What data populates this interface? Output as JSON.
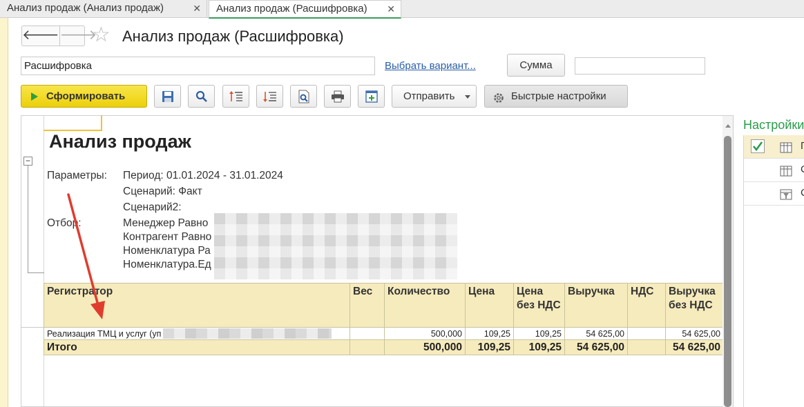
{
  "tabs": [
    {
      "label": "Анализ продаж (Анализ продаж)"
    },
    {
      "label": "Анализ продаж (Расшифровка)"
    }
  ],
  "header": {
    "title": "Анализ продаж (Расшифровка)",
    "back_icon": "arrow-left-icon",
    "forward_icon": "arrow-right-icon",
    "favorite_icon": "star-icon"
  },
  "variant": {
    "value": "Расшифровка",
    "choose_link": "Выбрать вариант...",
    "sum_button": "Сумма",
    "sum_value": ""
  },
  "toolbar": {
    "generate": "Сформировать",
    "send": "Отправить",
    "quick_settings": "Быстрые настройки",
    "icons": [
      "save-icon",
      "search-icon",
      "expand-groups-icon",
      "collapse-groups-icon",
      "print-preview-icon",
      "print-icon",
      "new-window-icon"
    ]
  },
  "report": {
    "title": "Анализ продаж",
    "params_label": "Параметры:",
    "params": [
      "Период: 01.01.2024 - 31.01.2024",
      "Сценарий: Факт",
      "Сценарий2:"
    ],
    "filter_label": "Отбор:",
    "filters": [
      "Менеджер Равно",
      "Контрагент Равно",
      "Номенклатура Ра",
      "Номенклатура.Ед"
    ],
    "columns": [
      "Регистратор",
      "Вес",
      "Количество",
      "Цена",
      "Цена без НДС",
      "Выручка",
      "НДС",
      "Выручка без НДС"
    ],
    "rows": [
      [
        "Реализация ТМЦ и услуг (уп",
        "",
        "500,000",
        "109,25",
        "109,25",
        "54 625,00",
        "",
        "54 625,00"
      ]
    ],
    "total": [
      "Итого",
      "",
      "500,000",
      "109,25",
      "109,25",
      "54 625,00",
      "",
      "54 625,00"
    ]
  },
  "settings_panel": {
    "title": "Настройки",
    "items": [
      {
        "label": "П",
        "checked": true
      },
      {
        "label": "С",
        "checked": false
      },
      {
        "label": "С",
        "checked": false
      }
    ]
  },
  "colors": {
    "accent_green": "#2a9c4b",
    "generate_button": "#ecd00a",
    "table_header": "#f6ebbd",
    "annotation_arrow": "#e03c2e"
  }
}
